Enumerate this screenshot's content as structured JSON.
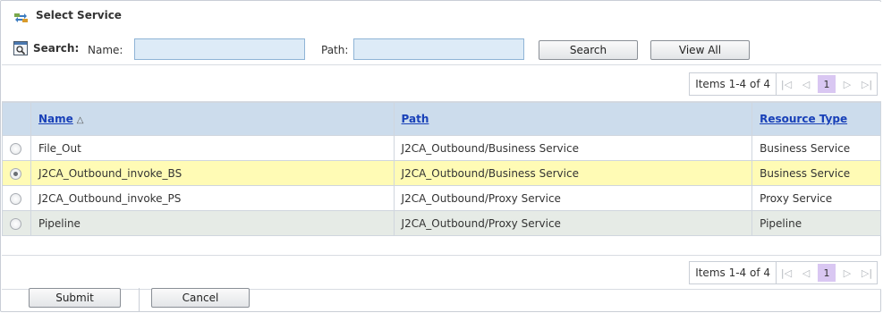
{
  "dialog": {
    "title": "Select Service",
    "title_icon": "service-swap-icon"
  },
  "search": {
    "label": "Search:",
    "icon": "search-window-icon",
    "name_label": "Name:",
    "name_value": "",
    "path_label": "Path:",
    "path_value": "",
    "search_button": "Search",
    "view_all_button": "View All"
  },
  "pager": {
    "items_text": "Items 1-4 of 4",
    "current_page": "1",
    "first_icon": "first-page-icon",
    "prev_icon": "previous-page-icon",
    "next_icon": "next-page-icon",
    "last_icon": "last-page-icon"
  },
  "table": {
    "columns": {
      "name": "Name",
      "path": "Path",
      "resource_type": "Resource Type"
    },
    "sort_icon": "sort-ascending-icon",
    "rows": [
      {
        "name": "File_Out",
        "path": "J2CA_Outbound/Business Service",
        "resource_type": "Business Service",
        "selected": false
      },
      {
        "name": "J2CA_Outbound_invoke_BS",
        "path": "J2CA_Outbound/Business Service",
        "resource_type": "Business Service",
        "selected": true
      },
      {
        "name": "J2CA_Outbound_invoke_PS",
        "path": "J2CA_Outbound/Proxy Service",
        "resource_type": "Proxy Service",
        "selected": false
      },
      {
        "name": "Pipeline",
        "path": "J2CA_Outbound/Proxy Service",
        "resource_type": "Pipeline",
        "selected": false
      }
    ]
  },
  "footer": {
    "submit_button": "Submit",
    "cancel_button": "Cancel"
  },
  "colors": {
    "header_bg": "#ccdcec",
    "selected_row_bg": "#fffbb5",
    "alt_row_bg": "#e6ebe6",
    "input_bg": "#ddebf7",
    "link_color": "#1840b8",
    "current_page_bg": "#d9c7f2"
  }
}
